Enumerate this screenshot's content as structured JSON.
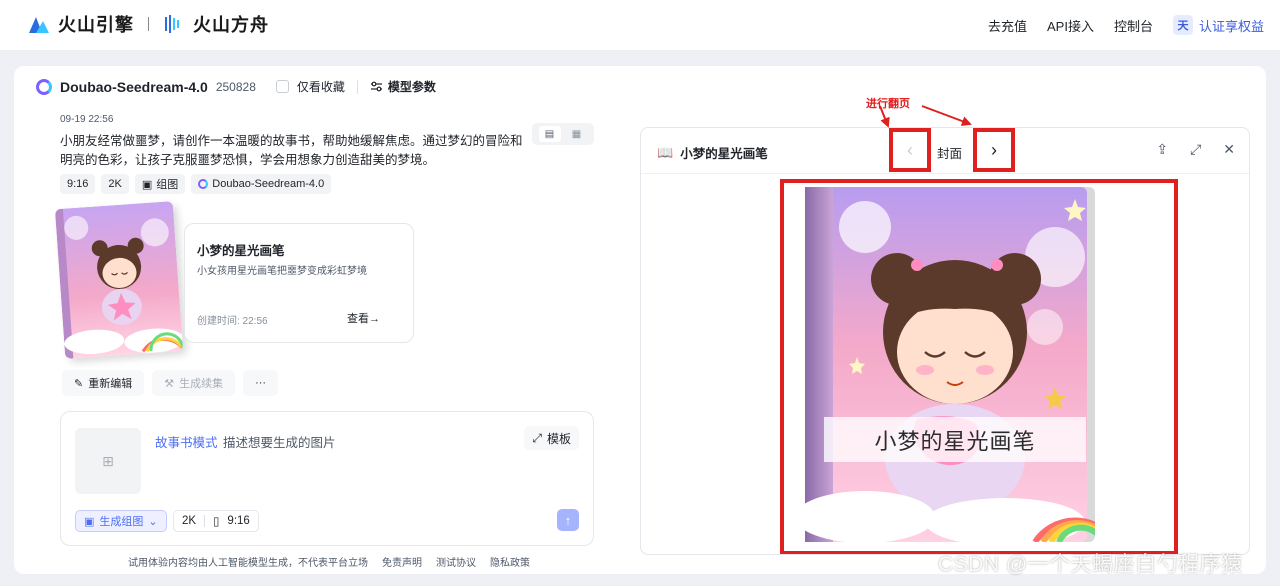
{
  "topbar": {
    "brand_primary": "火山引擎",
    "brand_secondary": "火山方舟",
    "nav": [
      "去充值",
      "API接入",
      "控制台"
    ],
    "avatar_letter": "天",
    "cert_label": "认证享权益"
  },
  "header": {
    "model_name": "Doubao-Seedream-4.0",
    "model_version": "250828",
    "favorites_only": "仅看收藏",
    "model_params": "模型参数"
  },
  "message": {
    "time": "09-19 22:56",
    "prompt": "小朋友经常做噩梦，请创作一本温暖的故事书，帮助她缓解焦虑。通过梦幻的冒险和明亮的色彩，让孩子克服噩梦恐惧，学会用想象力创造甜美的梦境。",
    "tags": [
      "9:16",
      "2K",
      "组图",
      "Doubao-Seedream-4.0"
    ]
  },
  "story_card": {
    "title": "小梦的星光画笔",
    "subtitle": "小女孩用星光画笔把噩梦变成彩虹梦境",
    "created": "创建时间: 22:56",
    "view": "查看→"
  },
  "actions": {
    "reedit": "重新编辑",
    "continue": "生成续集",
    "more": "···"
  },
  "composer": {
    "mode": "故事书模式",
    "placeholder": "描述想要生成的图片",
    "template": "模板",
    "generate": "生成组图",
    "resolution": "2K",
    "ratio": "9:16"
  },
  "footer": {
    "disclaimer": "试用体验内容均由人工智能模型生成，不代表平台立场",
    "links": [
      "免责声明",
      "测试协议",
      "隐私政策"
    ]
  },
  "viewer": {
    "title": "小梦的星光画笔",
    "page_label": "封面",
    "cover_title": "小梦的星光画笔"
  },
  "annotation": "进行翻页",
  "watermark": "CSDN @一个天蝎座白勺程序猿",
  "colors": {
    "accent": "#4c6ef5",
    "annotation_red": "#e01f1f",
    "cover_pink": "#f4a9c9"
  }
}
